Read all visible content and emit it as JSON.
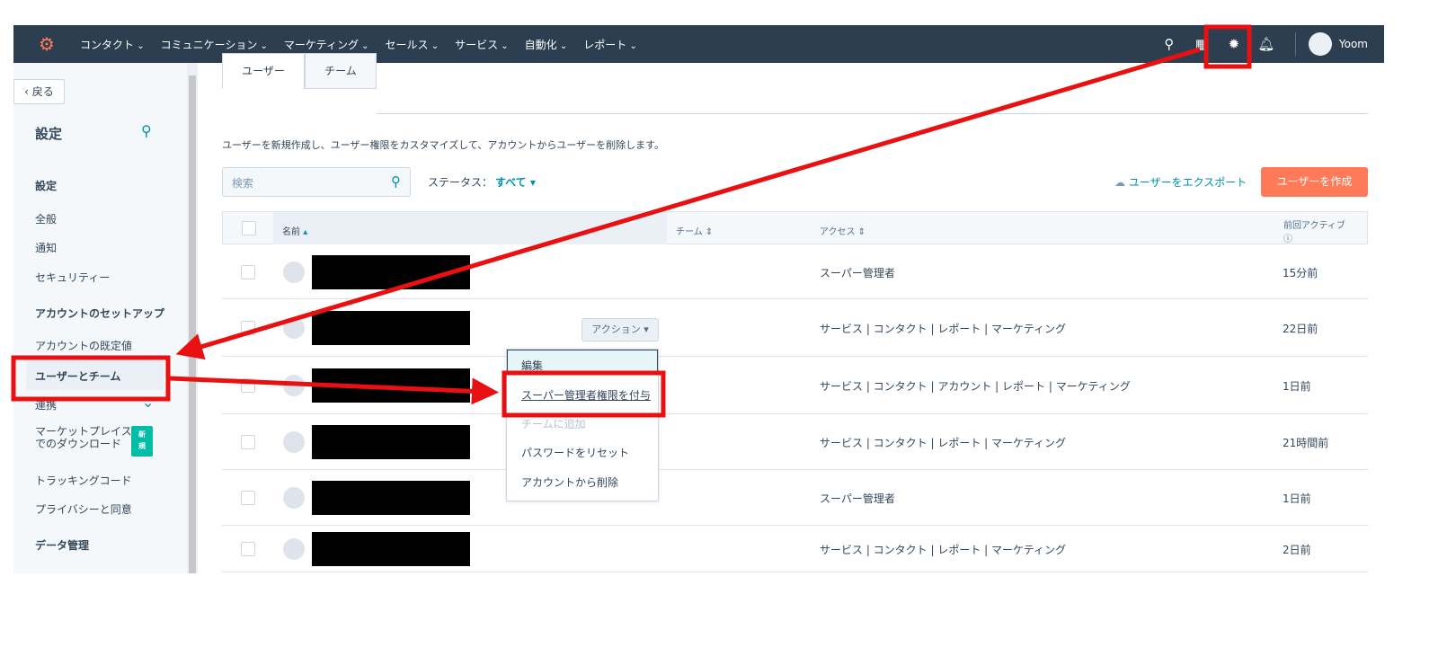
{
  "nav": {
    "menu": [
      "コンタクト",
      "コミュニケーション",
      "マーケティング",
      "セールス",
      "サービス",
      "自動化",
      "レポート"
    ],
    "user": "Yoom",
    "icons": [
      "search-icon",
      "marketplace-icon",
      "gear-icon",
      "bell-icon"
    ]
  },
  "sidebar": {
    "back": "戻る",
    "title": "設定",
    "section1": "設定",
    "items1": [
      "全般",
      "通知",
      "セキュリティー"
    ],
    "section2": "アカウントのセットアップ",
    "items2": [
      "アカウントの既定値",
      "ユーザーとチーム",
      "連携"
    ],
    "marketplace": [
      "マーケットプレイス",
      "でのダウンロード"
    ],
    "badge": "新規",
    "items3": [
      "トラッキングコード",
      "プライバシーと同意"
    ],
    "section3": "データ管理"
  },
  "tabs": [
    "ユーザー",
    "チーム"
  ],
  "description": "ユーザーを新規作成し、ユーザー権限をカスタマイズして、アカウントからユーザーを削除します。",
  "search": {
    "placeholder": "検索"
  },
  "status": {
    "label": "ステータス：",
    "value": "すべて"
  },
  "export": "ユーザーをエクスポート",
  "create": "ユーザーを作成",
  "columns": [
    "名前",
    "チーム",
    "アクセス",
    "前回アクティブ"
  ],
  "rows": [
    {
      "access": "スーパー管理者",
      "last": "15分前"
    },
    {
      "access": "サービス | コンタクト | レポート | マーケティング",
      "last": "22日前"
    },
    {
      "access": "サービス | コンタクト | アカウント | レポート | マーケティング",
      "last": "1日前"
    },
    {
      "access": "サービス | コンタクト | レポート | マーケティング",
      "last": "21時間前"
    },
    {
      "access": "スーパー管理者",
      "last": "1日前"
    },
    {
      "access": "サービス | コンタクト | レポート | マーケティング",
      "last": "2日前"
    }
  ],
  "action_button": "アクション",
  "dropdown": [
    "編集",
    "スーパー管理者権限を付与",
    "チームに追加",
    "パスワードをリセット",
    "アカウントから削除"
  ],
  "colors": {
    "nav": "#2d3e50",
    "accent": "#ff7a59",
    "link": "#0091ae",
    "annotation": "#e81010"
  }
}
